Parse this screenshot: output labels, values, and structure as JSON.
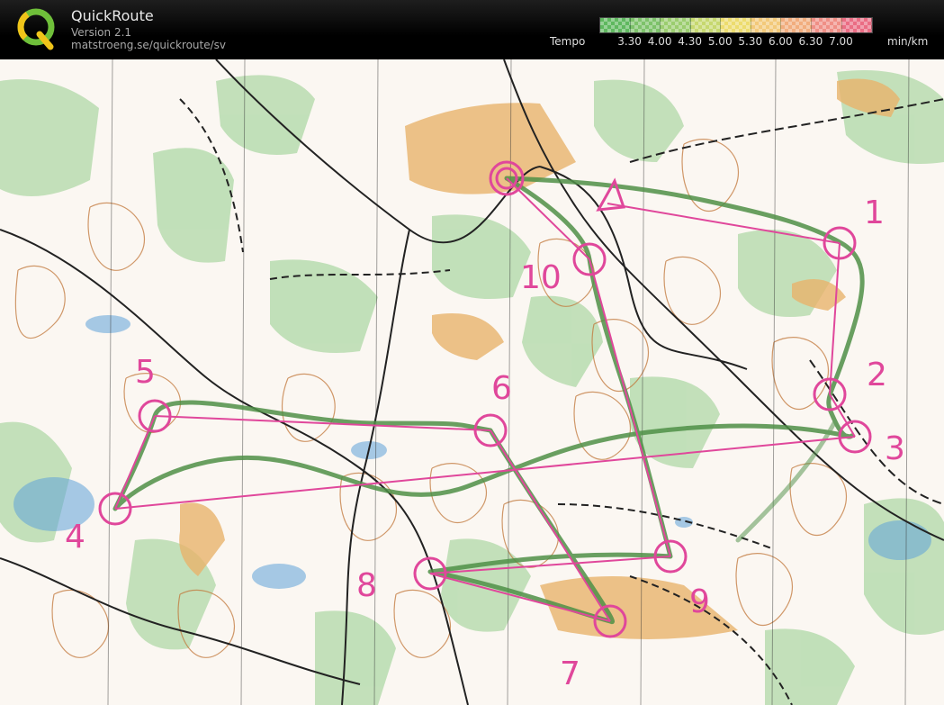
{
  "app": {
    "title": "QuickRoute",
    "version": "Version 2.1",
    "url": "matstroeng.se/quickroute/sv",
    "logo_letter": "Q"
  },
  "legend": {
    "label": "Tempo",
    "unit": "min/km",
    "ticks": [
      "3.30",
      "4.00",
      "4.30",
      "5.00",
      "5.30",
      "6.00",
      "6.30",
      "7.00"
    ],
    "colors": [
      "#5fb85f",
      "#7dc26a",
      "#9bcd6f",
      "#c6d86f",
      "#ecdc6e",
      "#f2c97a",
      "#f1ad7e",
      "#ef8f86",
      "#ea6d84"
    ]
  },
  "map": {
    "colors": {
      "course": "#e0479b",
      "route": "#4f8f47",
      "contour": "#c1773a",
      "forest": "#b8dcb0",
      "field": "#e9b36b",
      "water": "#5fa3d8"
    },
    "start_label": "start-triangle",
    "finish_label": "finish-circle",
    "controls": [
      {
        "number": "1"
      },
      {
        "number": "2"
      },
      {
        "number": "3"
      },
      {
        "number": "4"
      },
      {
        "number": "5"
      },
      {
        "number": "6"
      },
      {
        "number": "7"
      },
      {
        "number": "8"
      },
      {
        "number": "9"
      },
      {
        "number": "10"
      }
    ]
  }
}
